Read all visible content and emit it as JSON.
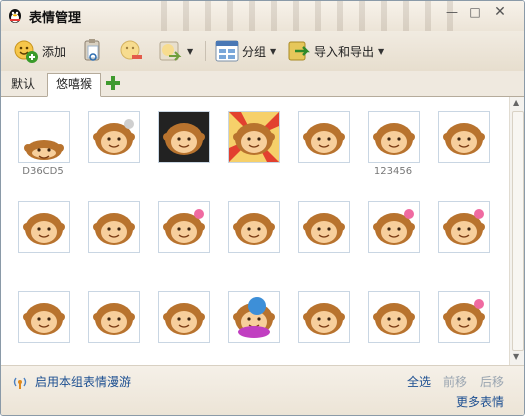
{
  "window": {
    "title": "表情管理",
    "app_icon": "qq-penguin-icon",
    "controls": [
      "minimize-icon",
      "maximize-icon",
      "close-icon"
    ]
  },
  "toolbar": {
    "add_label": "添加",
    "group_label": "分组",
    "import_export_label": "导入和导出"
  },
  "tabs": [
    {
      "label": "默认",
      "active": false
    },
    {
      "label": "悠嘻猴",
      "active": true
    }
  ],
  "emoticons": {
    "captions": [
      "D36CD5",
      "123456"
    ],
    "rows": [
      [
        "monkey-asleep",
        "monkey-tied-up",
        "monkey-shouting",
        "monkey-sunburst",
        "monkey-crying",
        "monkey-laughing",
        "monkey-blushing"
      ],
      [
        "monkey-smiling",
        "monkey-shy",
        "monkey-with-flower",
        "monkey-grinning",
        "monkey-hugging",
        "monkey-flower-laugh",
        "monkey-pink-flower"
      ],
      [
        "monkey-cheerful",
        "monkey-surprised",
        "monkey-rolling-eyes",
        "monkey-on-scooter",
        "monkey-angry",
        "monkey-smirking",
        "monkey-girl-flower"
      ]
    ]
  },
  "footer": {
    "roam_label": "启用本组表情漫游",
    "select_all": "全选",
    "move_forward": "前移",
    "move_back": "后移",
    "more": "更多表情"
  },
  "colors": {
    "link": "#1d4f91",
    "disabled_link": "#9aa5b1",
    "monkey_fur": "#b8732e",
    "monkey_face": "#f7cf9c"
  }
}
